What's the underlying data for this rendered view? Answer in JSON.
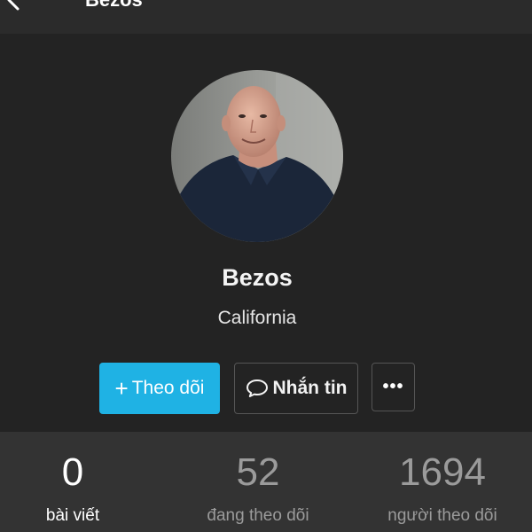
{
  "header": {
    "title": "Bezos",
    "back_icon": "chevron-left-icon"
  },
  "profile": {
    "name": "Bezos",
    "location": "California",
    "avatar": "profile-photo"
  },
  "actions": {
    "follow": {
      "icon": "plus-icon",
      "label": "Theo dõi"
    },
    "message": {
      "icon": "chat-bubble-icon",
      "label": "Nhắn tin"
    },
    "more": {
      "label": "•••"
    }
  },
  "stats": {
    "posts": {
      "value": "0",
      "label": "bài viết"
    },
    "following": {
      "value": "52",
      "label": "đang theo dõi"
    },
    "followers": {
      "value": "1694",
      "label": "người theo dõi"
    }
  },
  "colors": {
    "background": "#232323",
    "topbar": "#2b2b2b",
    "stats_bar": "#333333",
    "accent": "#1fb2e4",
    "muted_text": "#9b9b9b"
  }
}
